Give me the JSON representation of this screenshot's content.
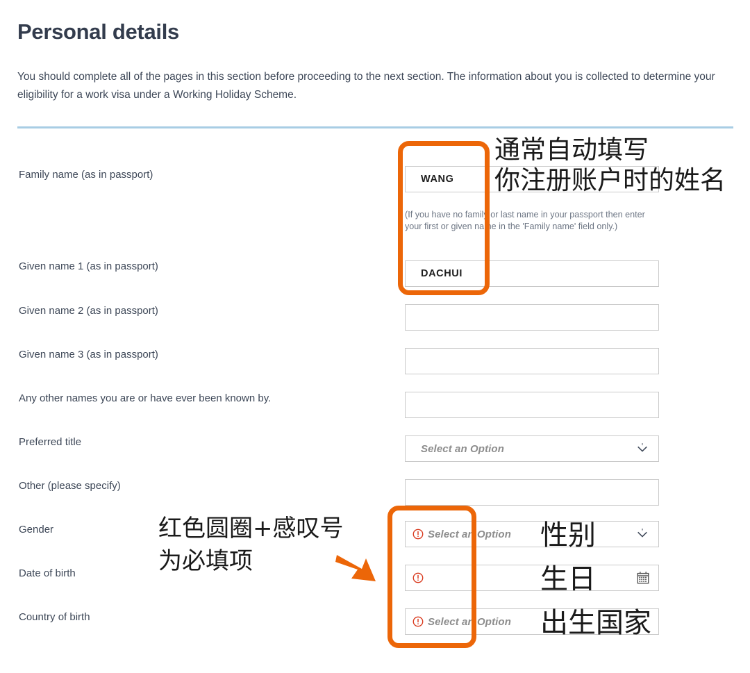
{
  "header": {
    "title": "Personal details",
    "intro": "You should complete all of the pages in this section before proceeding to the next section. The information about you is collected to determine your eligibility for a work visa under a Working Holiday Scheme."
  },
  "form": {
    "fields": [
      {
        "label": "Family name (as in passport)",
        "type": "text",
        "value": "WANG",
        "placeholder": "",
        "required": false,
        "help": "(If you have no family or last name in your passport then enter your first or given name in the 'Family name' field only.)"
      },
      {
        "label": "Given name 1 (as in passport)",
        "type": "text",
        "value": "DACHUI",
        "placeholder": "",
        "required": false
      },
      {
        "label": "Given name 2 (as in passport)",
        "type": "text",
        "value": "",
        "placeholder": "",
        "required": false
      },
      {
        "label": "Given name 3 (as in passport)",
        "type": "text",
        "value": "",
        "placeholder": "",
        "required": false
      },
      {
        "label": "Any other names you are or have ever been known by.",
        "type": "text",
        "value": "",
        "placeholder": "",
        "required": false
      },
      {
        "label": "Preferred title",
        "type": "select",
        "value": "",
        "placeholder": "Select an Option",
        "required": false
      },
      {
        "label": "Other (please specify)",
        "type": "text",
        "value": "",
        "placeholder": "",
        "required": false
      },
      {
        "label": "Gender",
        "type": "select",
        "value": "",
        "placeholder": "Select an Option",
        "required": true
      },
      {
        "label": "Date of birth",
        "type": "date",
        "value": "",
        "placeholder": "",
        "required": true
      },
      {
        "label": "Country of birth",
        "type": "select",
        "value": "",
        "placeholder": "Select an Option",
        "required": true
      }
    ]
  },
  "annotations": {
    "note_autofill_line1": "通常自动填写",
    "note_autofill_line2": "你注册账户时的姓名",
    "note_required_line1": "红色圆圈+感叹号",
    "note_required_line2": "为必填项",
    "overlay_gender": "性别",
    "overlay_dob": "生日",
    "overlay_country": "出生国家"
  },
  "colors": {
    "highlight": "#ec6608",
    "required": "#d93a1e",
    "rule": "#a8cde4",
    "text": "#3d4757"
  }
}
